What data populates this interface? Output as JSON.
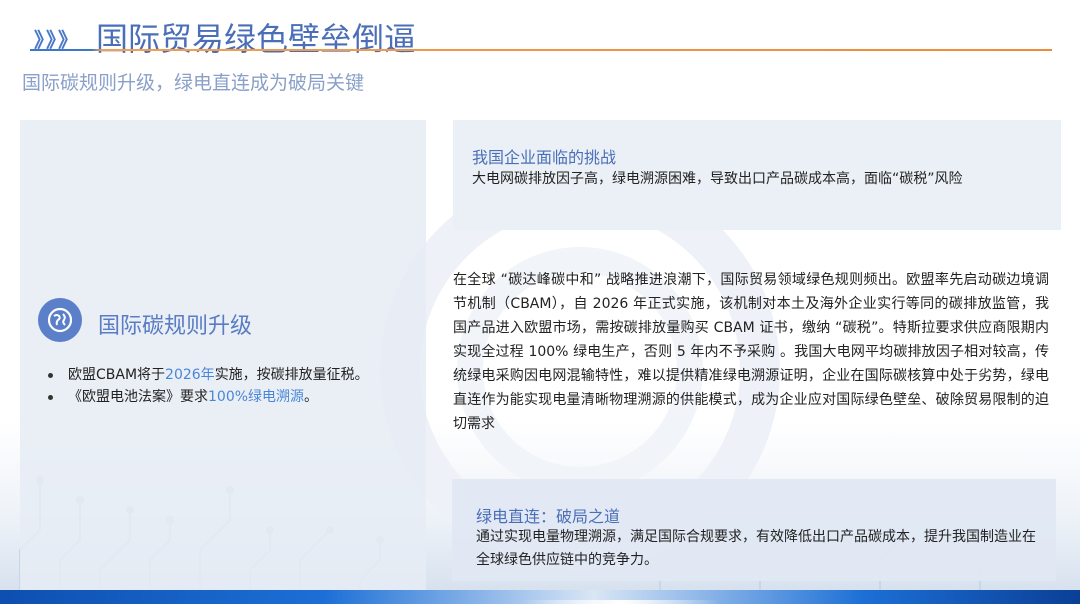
{
  "header": {
    "chevrons": "》》》",
    "title": "国际贸易绿色壁垒倒逼",
    "subtitle": "国际碳规则升级，绿电直连成为破局关键"
  },
  "left_panel": {
    "icon": "earth-icon",
    "heading": "国际碳规则升级",
    "bullets": [
      {
        "pre": "欧盟CBAM将于",
        "highlight": "2026年",
        "post": "实施，按碳排放量征税。"
      },
      {
        "pre": "《欧盟电池法案》要求",
        "highlight": "100%绿电溯源",
        "post": "。"
      }
    ]
  },
  "challenge_card": {
    "title": "我国企业面临的挑战",
    "text": "大电网碳排放因子高，绿电溯源困难，导致出口产品碳成本高，面临“碳税”风险"
  },
  "body_paragraph": "在全球 “碳达峰碳中和” 战略推进浪潮下，国际贸易领域绿色规则频出。欧盟率先启动碳边境调节机制（CBAM），自 2026 年正式实施，该机制对本土及海外企业实行等同的碳排放监管，我国产品进入欧盟市场，需按碳排放量购买 CBAM 证书，缴纳 “碳税”。特斯拉要求供应商限期内实现全过程 100% 绿电生产，否则 5 年内不予采购 。我国大电网平均碳排放因子相对较高，传统绿电采购因电网混输特性，难以提供精准绿电溯源证明，企业在国际碳核算中处于劣势，绿电直连作为能实现电量清晰物理溯源的供能模式，成为企业应对国际绿色壁垒、破除贸易限制的迫切需求",
  "solution_card": {
    "title": "绿电直连：破局之道",
    "text": "通过实现电量物理溯源，满足国际合规要求，有效降低出口产品碳成本，提升我国制造业在全球绿色供应链中的竞争力。"
  },
  "colors": {
    "accent_blue": "#4a6fb8",
    "highlight_blue": "#4a86d8",
    "accent_orange": "#f08a3a"
  }
}
